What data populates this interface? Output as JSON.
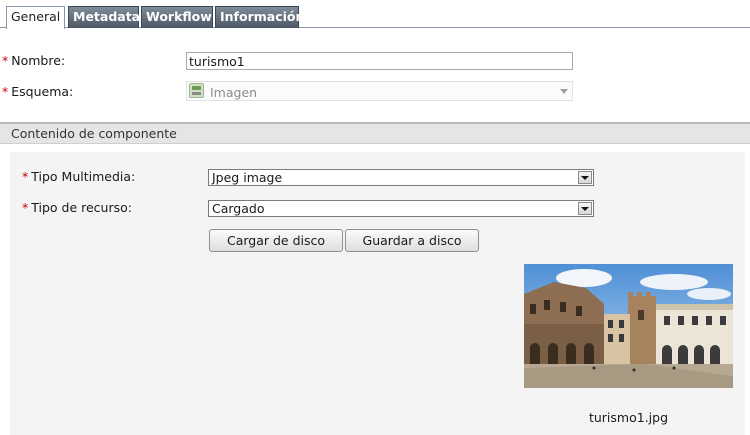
{
  "tabs": [
    {
      "label": "General",
      "active": true
    },
    {
      "label": "Metadata",
      "active": false
    },
    {
      "label": "Workflow",
      "active": false
    },
    {
      "label": "Información",
      "active": false
    }
  ],
  "form": {
    "required_mark": "*",
    "name_label": "Nombre:",
    "name_value": "turismo1",
    "schema_label": "Esquema:",
    "schema_value": "Imagen",
    "schema_icon": "schema-image-icon"
  },
  "component_section": {
    "title": "Contenido de componente",
    "multimedia_type_label": "Tipo Multimedia:",
    "multimedia_type_value": "Jpeg image",
    "resource_type_label": "Tipo de recurso:",
    "resource_type_value": "Cargado",
    "upload_button": "Cargar de disco",
    "save_button": "Guardar a disco",
    "preview_filename": "turismo1.jpg"
  },
  "colors": {
    "required": "#cc0000",
    "tab_inactive_bg": "#5a6674",
    "section_header_bg": "#e5e5e5"
  }
}
